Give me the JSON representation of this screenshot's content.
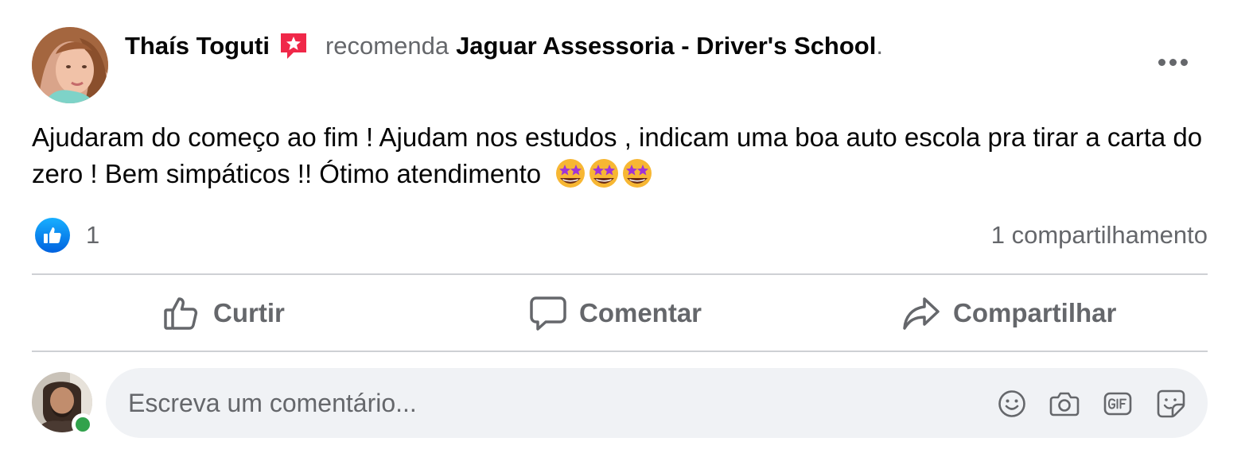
{
  "post": {
    "author_name": "Thaís Toguti",
    "recommend_word": "recomenda",
    "page_name": "Jaguar Assessoria - Driver's School",
    "period": ".",
    "text": "Ajudaram do começo ao fim ! Ajudam nos estudos , indicam uma boa auto escola pra tirar a carta do zero ! Bem simpáticos !! Ótimo atendimento",
    "emojis": [
      "star-struck-emoji",
      "star-struck-emoji",
      "star-struck-emoji"
    ],
    "like_count": "1",
    "share_count": "1 compartilhamento"
  },
  "actions": {
    "like_label": "Curtir",
    "comment_label": "Comentar",
    "share_label": "Compartilhar"
  },
  "composer": {
    "placeholder": "Escreva um comentário..."
  },
  "icons": {
    "recommend": "recommend-star-icon",
    "more": "more-options-icon",
    "like_badge": "like-reaction-icon",
    "like_action": "thumbs-up-outline-icon",
    "comment_action": "speech-bubble-icon",
    "share_action": "share-arrow-icon",
    "composer_tools": [
      "emoji-icon",
      "camera-icon",
      "gif-icon",
      "sticker-icon"
    ]
  },
  "colors": {
    "text_primary": "#050505",
    "text_secondary": "#65676b",
    "like_blue": "#0866ff",
    "recommend_red": "#f02849",
    "online_green": "#31a24c",
    "composer_bg": "#f0f2f5",
    "divider": "#ced0d4"
  }
}
